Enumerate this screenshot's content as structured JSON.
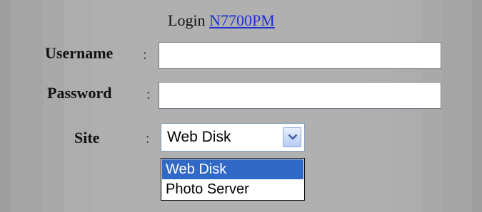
{
  "header": {
    "prefix": "Login",
    "device_link": "N7700PM"
  },
  "form": {
    "username_label": "Username",
    "password_label": "Password",
    "site_label": "Site",
    "separator": ":",
    "username_value": "",
    "password_value": "",
    "site_selected": "Web Disk",
    "site_options": [
      "Web Disk",
      "Photo Server"
    ],
    "highlighted_option": "Web Disk"
  },
  "icons": {
    "site_dropdown_toggle": "chevron-down-icon"
  },
  "colors": {
    "page_background": "#a7a7a7",
    "link": "#1f2fd6",
    "selection_highlight": "#3169c6"
  }
}
